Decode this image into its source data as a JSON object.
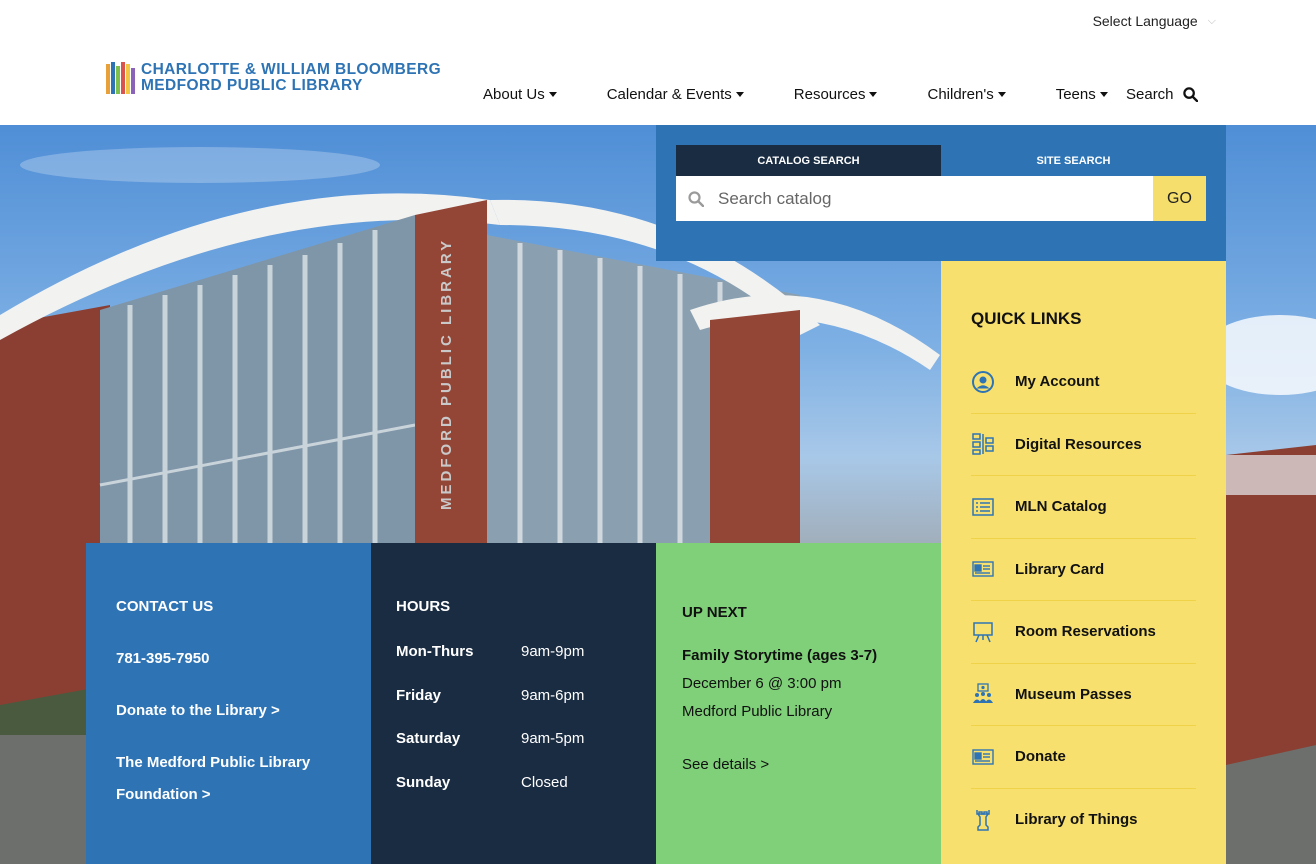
{
  "header": {
    "language_select": "Select Language",
    "logo_line1": "CHARLOTTE & WILLIAM BLOOMBERG",
    "logo_line2": "MEDFORD PUBLIC LIBRARY",
    "nav": [
      {
        "label": "About Us"
      },
      {
        "label": "Calendar & Events"
      },
      {
        "label": "Resources"
      },
      {
        "label": "Children's"
      },
      {
        "label": "Teens"
      }
    ],
    "search_label": "Search"
  },
  "hero": {
    "building_sign": "MEDFORD PUBLIC LIBRARY"
  },
  "search": {
    "tabs": [
      {
        "label": "CATALOG SEARCH",
        "active": true
      },
      {
        "label": "SITE SEARCH",
        "active": false
      }
    ],
    "placeholder": "Search catalog",
    "go_label": "GO"
  },
  "quick_links": {
    "title": "QUICK LINKS",
    "items": [
      {
        "label": "My Account",
        "icon": "user-circle-icon"
      },
      {
        "label": "Digital Resources",
        "icon": "digital-resources-icon"
      },
      {
        "label": "MLN Catalog",
        "icon": "list-icon"
      },
      {
        "label": "Library Card",
        "icon": "id-card-icon"
      },
      {
        "label": "Room Reservations",
        "icon": "presentation-board-icon"
      },
      {
        "label": "Museum Passes",
        "icon": "group-icon"
      },
      {
        "label": "Donate",
        "icon": "id-card-icon"
      },
      {
        "label": "Library of Things",
        "icon": "chess-rook-icon"
      }
    ]
  },
  "contact": {
    "title": "CONTACT US",
    "phone": "781-395-7950",
    "donate": "Donate to the Library >",
    "foundation_line1": "The Medford Public Library",
    "foundation_line2": "Foundation >"
  },
  "hours": {
    "title": "HOURS",
    "rows": [
      {
        "day": "Mon-Thurs",
        "time": "9am-9pm"
      },
      {
        "day": "Friday",
        "time": "9am-6pm"
      },
      {
        "day": "Saturday",
        "time": "9am-5pm"
      },
      {
        "day": "Sunday",
        "time": "Closed"
      }
    ]
  },
  "up_next": {
    "title": "UP NEXT",
    "event_name": "Family Storytime (ages 3-7)",
    "event_date": "December 6 @ 3:00 pm",
    "event_location": "Medford Public Library",
    "details_link": "See details >"
  },
  "colors": {
    "brand_blue": "#2e74b5",
    "navy": "#1a2c42",
    "yellow": "#f7e06d",
    "green": "#7fd079",
    "go_yellow": "#f5de6b"
  }
}
